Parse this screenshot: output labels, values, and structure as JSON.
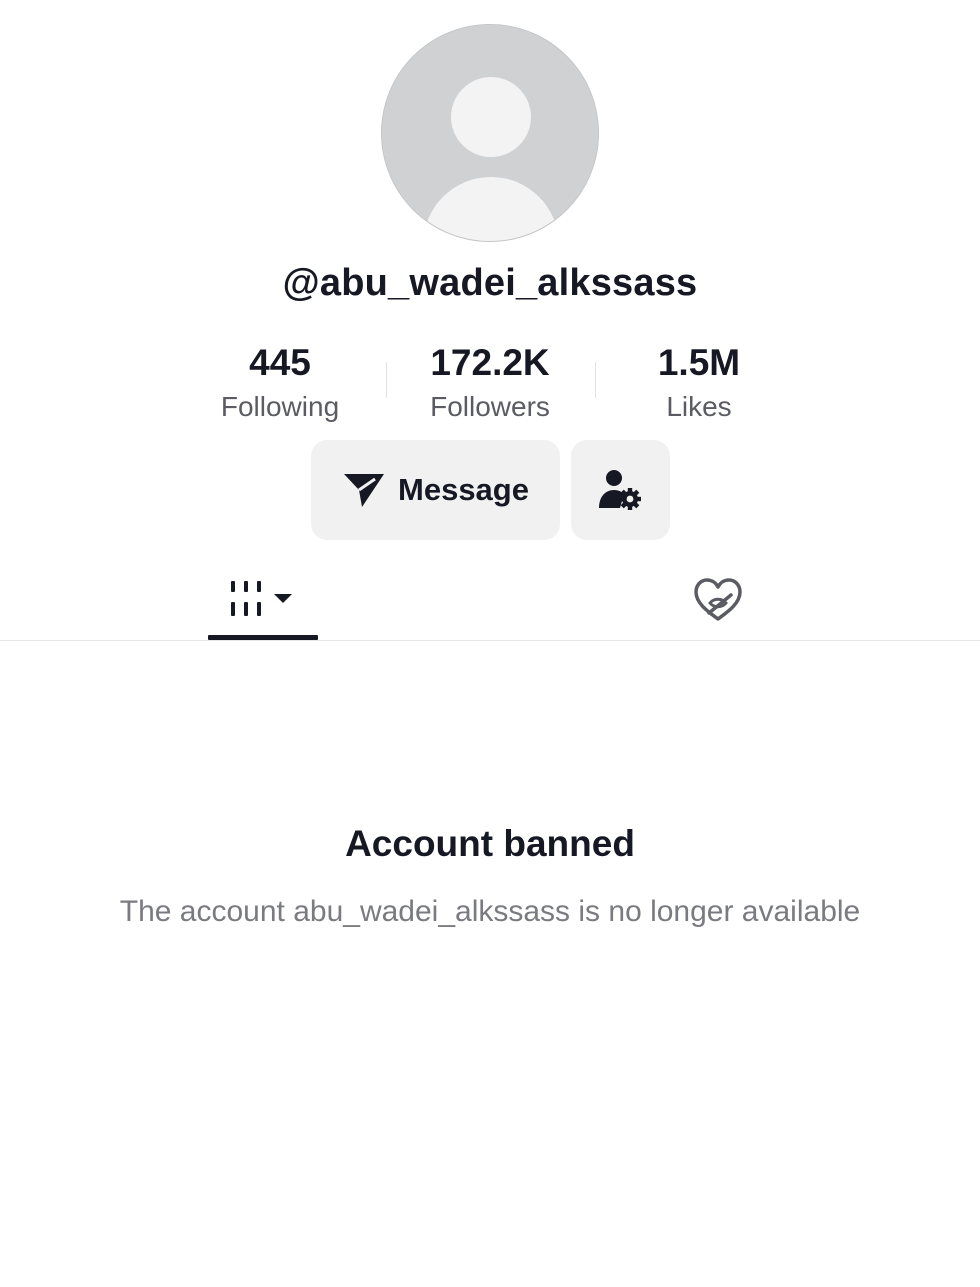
{
  "profile": {
    "username": "@abu_wadei_alkssass",
    "avatar_icon": "default-avatar-icon"
  },
  "stats": [
    {
      "value": "445",
      "label": "Following"
    },
    {
      "value": "172.2K",
      "label": "Followers"
    },
    {
      "value": "1.5M",
      "label": "Likes"
    }
  ],
  "actions": {
    "message_label": "Message",
    "message_icon": "send-icon",
    "follow_options_icon": "user-settings-icon"
  },
  "tabs": [
    {
      "name": "videos",
      "icon": "grid-menu-icon",
      "active": true
    },
    {
      "name": "liked",
      "icon": "heart-hidden-icon",
      "active": false
    }
  ],
  "notice": {
    "title": "Account banned",
    "body": "The account abu_wadei_alkssass is no longer available"
  },
  "colors": {
    "text_primary": "#161823",
    "text_secondary": "#5b5c63",
    "text_muted": "#7a7b80",
    "button_bg": "#f1f1f2",
    "avatar_bg": "#d0d1d3"
  }
}
